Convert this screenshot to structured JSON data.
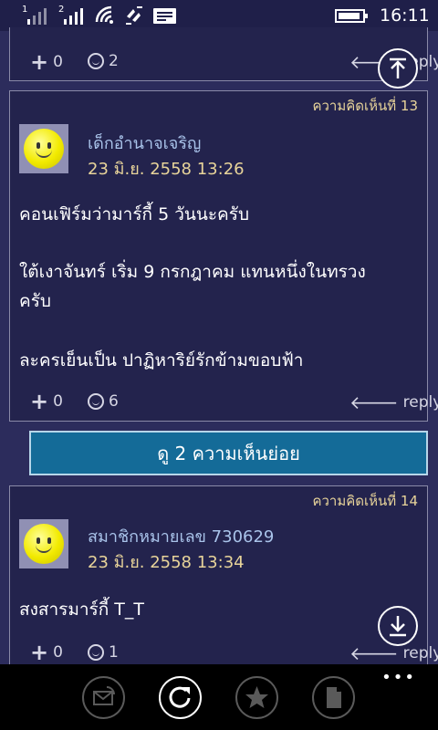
{
  "status": {
    "sim1": "1",
    "sim2": "2",
    "time": "16:11"
  },
  "comments": [
    {
      "plus_count": "0",
      "emotion_count": "2",
      "reply_label": "reply"
    },
    {
      "number_label": "ความคิดเห็นที่ 13",
      "author": "เด็กอำนาจเจริญ",
      "date": "23 มิ.ย. 2558 13:26",
      "lines": [
        "คอนเฟิร์มว่ามาร์กี้ 5 วันนะครับ",
        "ใต้เงาจันทร์ เริ่ม 9 กรกฎาคม แทนหนึ่งในทรวง",
        "ครับ",
        "ละครเย็นเป็น ปาฏิหาริย์รักข้ามขอบฟ้า"
      ],
      "plus_count": "0",
      "emotion_count": "6",
      "reply_label": "reply"
    },
    {
      "number_label": "ความคิดเห็นที่ 14",
      "author": "สมาชิกหมายเลข 730629",
      "date": "23 มิ.ย. 2558 13:34",
      "lines": [
        "สงสารมาร์กี้ T_T"
      ],
      "plus_count": "0",
      "emotion_count": "1",
      "reply_label": "reply"
    }
  ],
  "sub_replies_button": "ดู 2 ความเห็นย่อย",
  "appbar": {
    "buttons": [
      "share-icon",
      "refresh-icon",
      "star-icon",
      "document-icon"
    ],
    "more": "•••"
  },
  "float_buttons": [
    "scroll-top-icon",
    "scroll-bottom-icon"
  ],
  "colors": {
    "background": "#2c2c5c",
    "card": "#23234d",
    "accent_button": "#146b98",
    "date": "#e8d49a",
    "author": "#a9c3ea"
  }
}
